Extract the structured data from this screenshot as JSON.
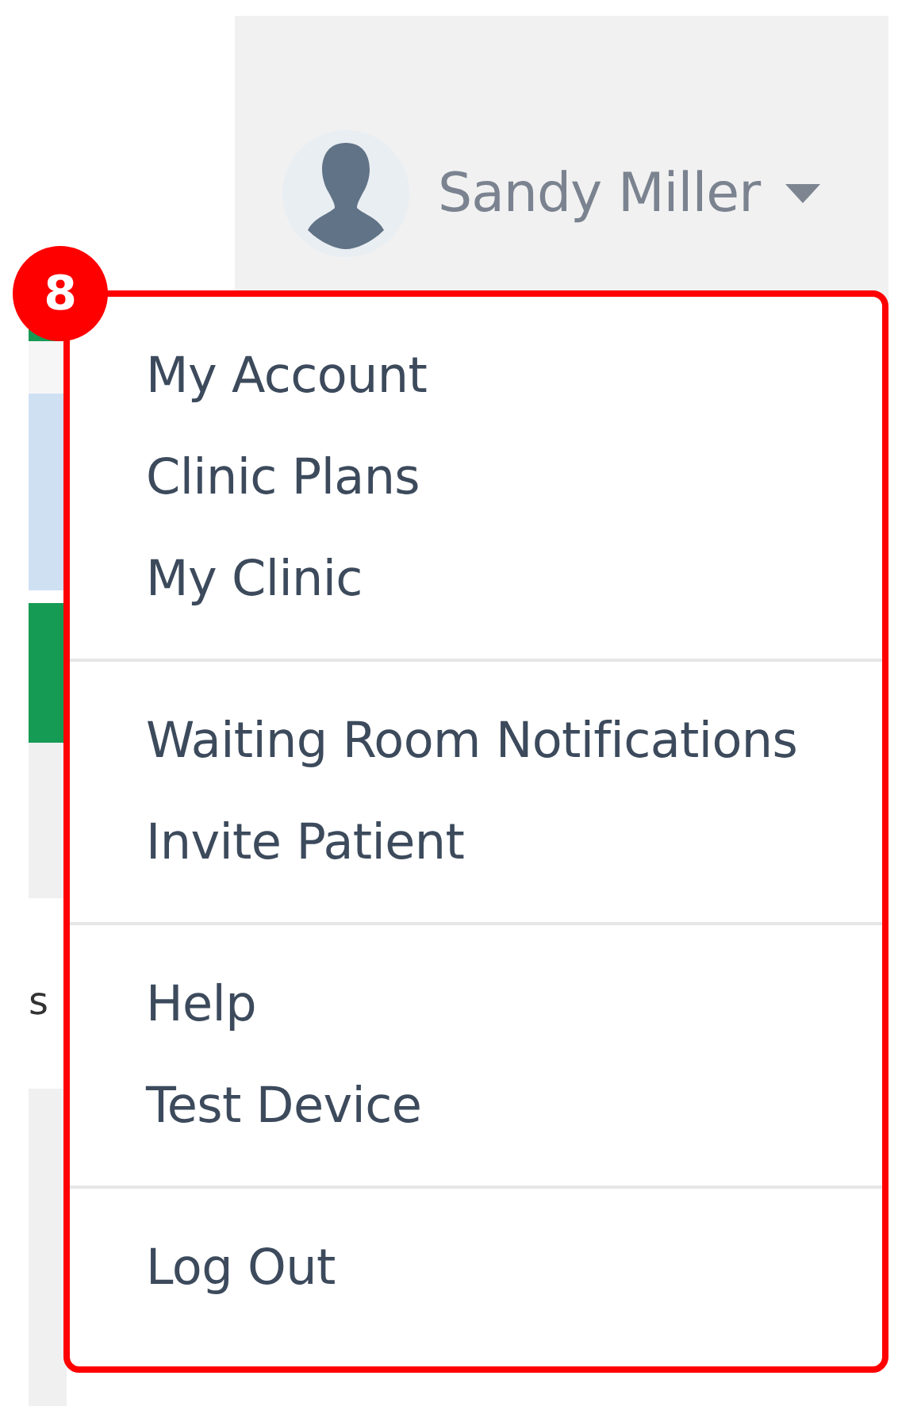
{
  "header": {
    "user_name": "Sandy Miller"
  },
  "background_text": "s",
  "callout": {
    "number": "8"
  },
  "menu": {
    "groups": [
      {
        "items": [
          "My Account",
          "Clinic Plans",
          "My Clinic"
        ]
      },
      {
        "items": [
          "Waiting Room Notifications",
          "Invite Patient"
        ]
      },
      {
        "items": [
          "Help",
          "Test Device"
        ]
      },
      {
        "items": [
          "Log Out"
        ]
      }
    ]
  }
}
